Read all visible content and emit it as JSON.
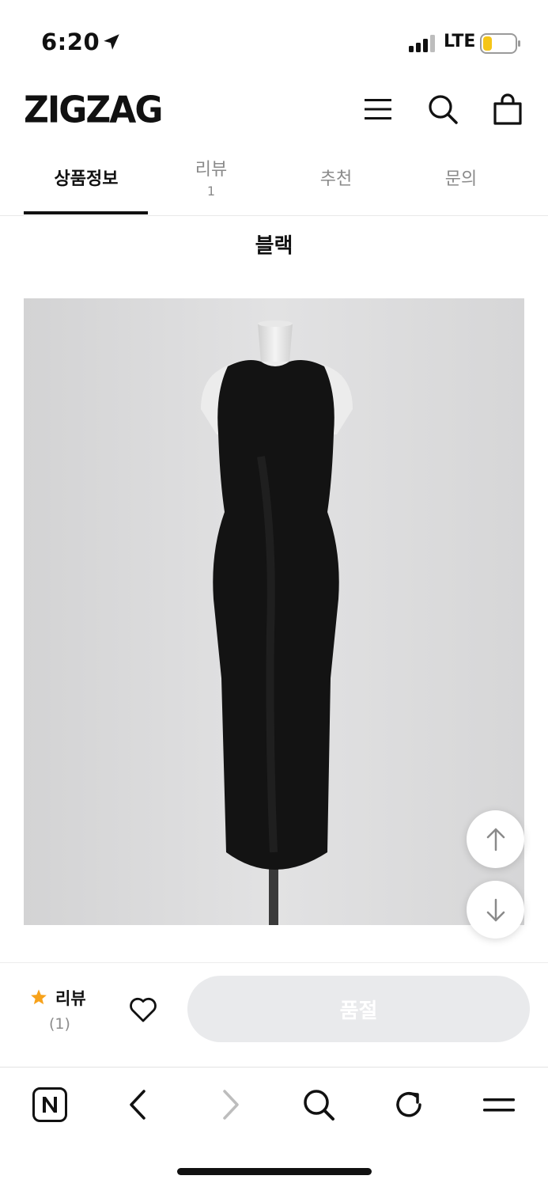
{
  "status_bar": {
    "time": "6:20",
    "network": "LTE",
    "icons": [
      "location-arrow-icon",
      "signal-icon",
      "battery-icon"
    ],
    "battery_color": "#f5c518"
  },
  "header": {
    "logo": "ZIGZAG",
    "icons": [
      "menu-icon",
      "search-icon",
      "shopping-bag-icon"
    ]
  },
  "tabs": [
    {
      "label": "상품정보",
      "count": "",
      "active": true
    },
    {
      "label": "리뷰",
      "count": "1",
      "active": false
    },
    {
      "label": "추천",
      "count": "",
      "active": false
    },
    {
      "label": "문의",
      "count": "",
      "active": false
    }
  ],
  "content": {
    "color_title": "블랙",
    "image_alt_icon": "black-dress-product-image"
  },
  "scroll_buttons": {
    "up": "arrow-up-icon",
    "down": "arrow-down-icon"
  },
  "purchase_bar": {
    "review_label": "리뷰",
    "review_count": "(1)",
    "star_color": "#f7a21b",
    "wishlist_icon": "heart-icon",
    "soldout_label": "품절"
  },
  "browser_bar": {
    "icons": [
      "naver-home-icon",
      "back-icon",
      "forward-icon",
      "search-icon",
      "reload-icon",
      "menu-icon"
    ]
  }
}
